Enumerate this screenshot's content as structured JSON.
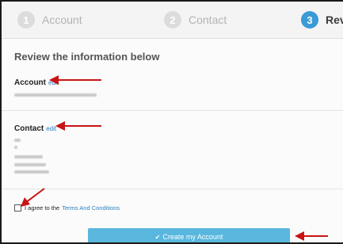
{
  "stepper": {
    "steps": [
      {
        "number": "1",
        "label": "Account"
      },
      {
        "number": "2",
        "label": "Contact"
      },
      {
        "number": "3",
        "label": "Rev"
      }
    ]
  },
  "main": {
    "heading": "Review the information below",
    "account": {
      "title": "Account",
      "edit_label": "edit"
    },
    "contact": {
      "title": "Contact",
      "edit_label": "edit"
    },
    "agree": {
      "text": "I agree to the",
      "link": "Terms And Conditions",
      "checked": false
    },
    "create_button": {
      "label": "Create my Account",
      "icon": "checkmark-icon"
    }
  },
  "colors": {
    "accent": "#3a9bd5",
    "button": "#59b7de",
    "link": "#2a7fc2",
    "annotation": "#c81414"
  }
}
